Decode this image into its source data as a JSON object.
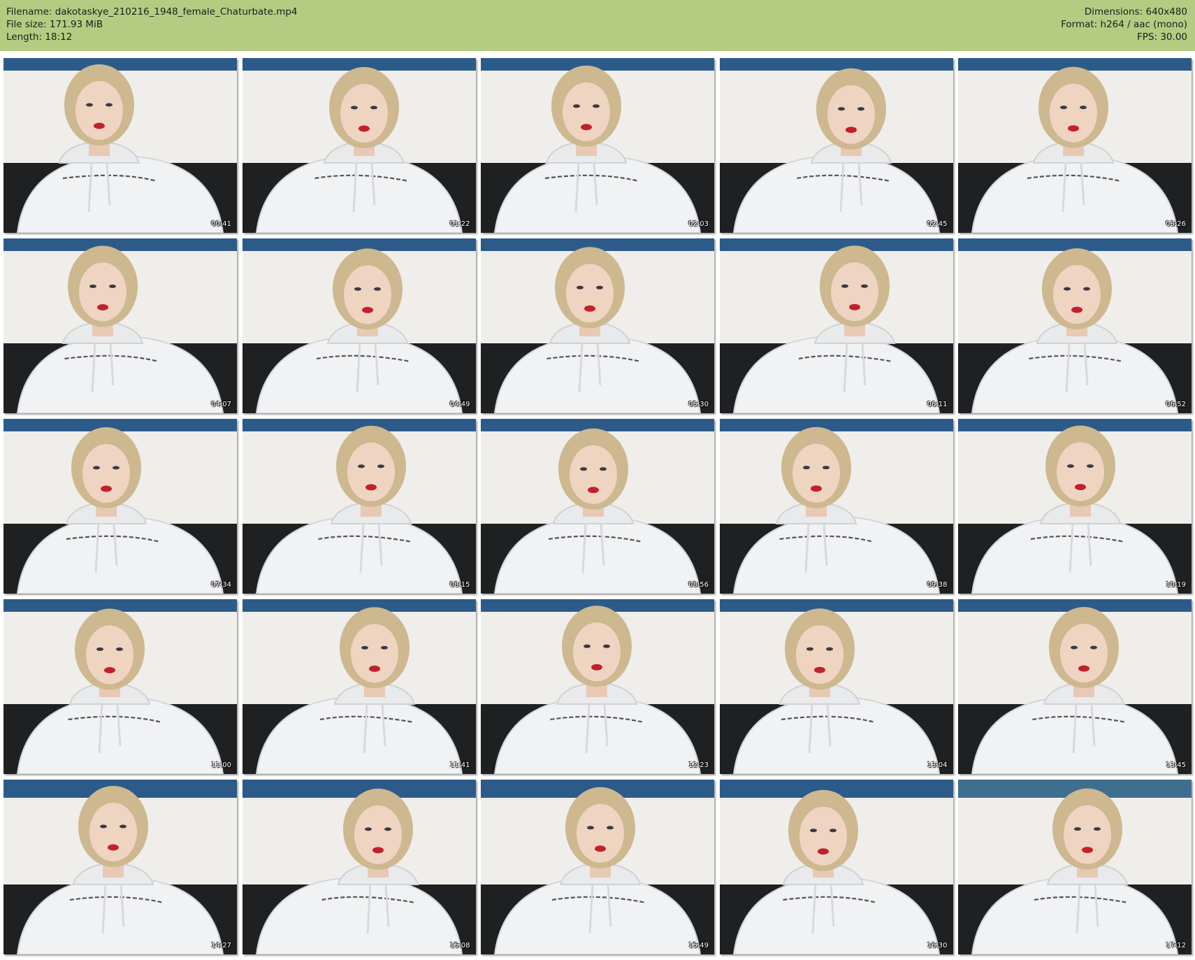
{
  "header": {
    "filename": "Filename: dakotaskye_210216_1948_female_Chaturbate.mp4",
    "filesize": "File size: 171.93 MiB",
    "length": "Length: 18:12",
    "dimensions": "Dimensions: 640x480",
    "format": "Format: h264 / aac (mono)",
    "fps": "FPS: 30.00"
  },
  "thumbnails": [
    {
      "time": "00:41"
    },
    {
      "time": "01:22"
    },
    {
      "time": "02:03"
    },
    {
      "time": "02:45"
    },
    {
      "time": "03:26"
    },
    {
      "time": "04:07"
    },
    {
      "time": "04:49"
    },
    {
      "time": "05:30"
    },
    {
      "time": "06:11"
    },
    {
      "time": "06:52"
    },
    {
      "time": "07:34"
    },
    {
      "time": "08:15"
    },
    {
      "time": "08:56"
    },
    {
      "time": "09:38"
    },
    {
      "time": "10:19"
    },
    {
      "time": "11:00"
    },
    {
      "time": "11:41"
    },
    {
      "time": "12:23"
    },
    {
      "time": "13:04"
    },
    {
      "time": "13:45"
    },
    {
      "time": "14:27"
    },
    {
      "time": "15:08"
    },
    {
      "time": "15:49"
    },
    {
      "time": "16:30"
    },
    {
      "time": "17:12"
    }
  ],
  "colors": {
    "header_bg": "#b3cc82",
    "header_text": "#1c1c1c",
    "page_bg": "#ffffff",
    "timestamp_text": "#ffffff"
  }
}
